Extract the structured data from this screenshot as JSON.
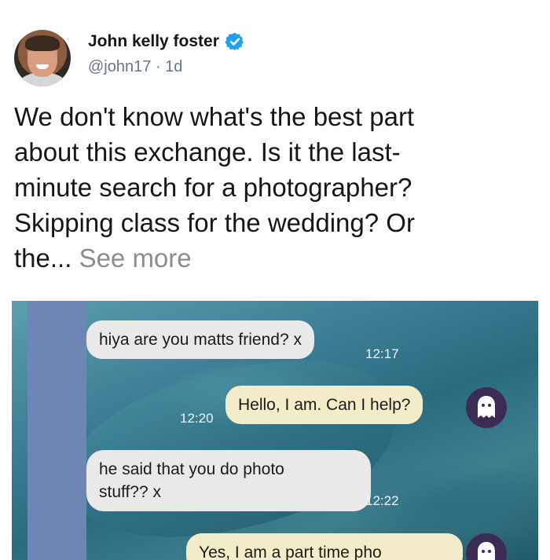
{
  "author": {
    "name": "John kelly foster",
    "handle": "@john17",
    "separator": "·",
    "time": "1d"
  },
  "tweet": {
    "line1": "We don't know what's the best part",
    "line2": "about this exchange. Is it the last-",
    "line3": "minute search for a photographer?",
    "line4": "Skipping class for the wedding? Or",
    "line5": "the...",
    "see_more": "See more"
  },
  "chat": [
    {
      "side": "in",
      "text": "hiya are you matts friend? x",
      "time": "12:17"
    },
    {
      "side": "out",
      "text": "Hello, I am. Can I help?",
      "time": "12:20"
    },
    {
      "side": "in",
      "text_line1": "he said that you do photo",
      "text_line2": "stuff?? x",
      "time": "12:22"
    },
    {
      "side": "out",
      "text": "Yes, I am a part time pho"
    }
  ],
  "colors": {
    "verified": "#1da1f2",
    "name": "#14171a",
    "handle": "#657786",
    "see_more": "#8a8d91"
  },
  "icons": {
    "verified": "verified-badge-icon",
    "contact": "ghost-avatar-icon"
  }
}
